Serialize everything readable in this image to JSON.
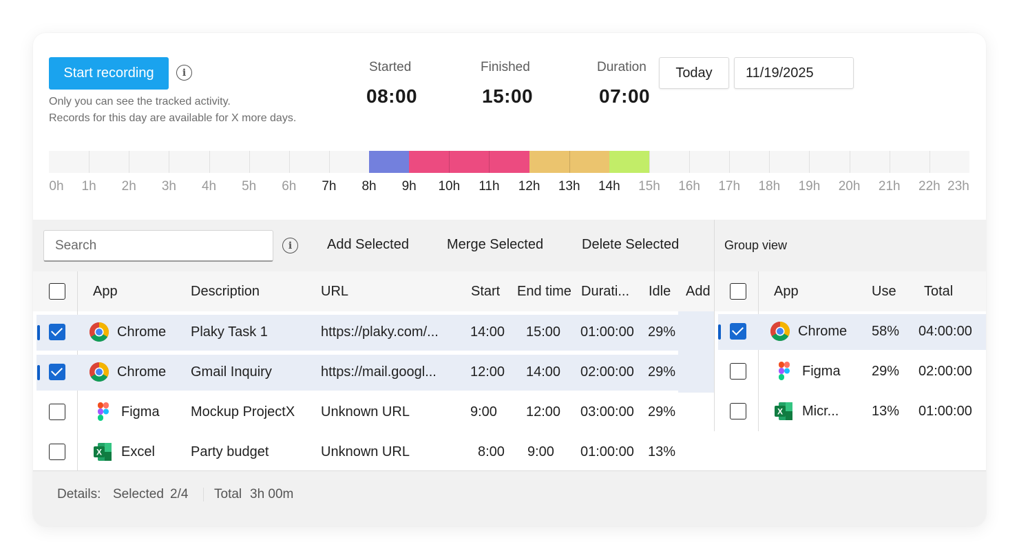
{
  "header": {
    "record_label": "Start recording",
    "note_line1": "Only you can see the tracked activity.",
    "note_line2": "Records for this day are available for X more days.",
    "started_label": "Started",
    "started_value": "08:00",
    "finished_label": "Finished",
    "finished_value": "15:00",
    "duration_label": "Duration",
    "duration_value": "07:00",
    "today_label": "Today",
    "date_value": "11/19/2025"
  },
  "timeline": {
    "hours": [
      "0h",
      "1h",
      "2h",
      "3h",
      "4h",
      "5h",
      "6h",
      "7h",
      "8h",
      "9h",
      "10h",
      "11h",
      "12h",
      "13h",
      "14h",
      "15h",
      "16h",
      "17h",
      "18h",
      "19h",
      "20h",
      "21h",
      "22h",
      "23h"
    ],
    "active_hours": [
      "7h",
      "8h",
      "9h",
      "10h",
      "11h",
      "12h",
      "13h",
      "14h"
    ],
    "segments": [
      {
        "start": 8,
        "end": 9,
        "color": "#7380dd"
      },
      {
        "start": 9,
        "end": 12,
        "color": "#ec4b80"
      },
      {
        "start": 12,
        "end": 14,
        "color": "#ebc46e"
      },
      {
        "start": 14,
        "end": 15,
        "color": "#c2ed68"
      }
    ]
  },
  "toolbar": {
    "search_placeholder": "Search",
    "add_selected": "Add Selected",
    "merge_selected": "Merge Selected",
    "delete_selected": "Delete Selected",
    "group_view": "Group view"
  },
  "activity_table": {
    "columns": [
      "App",
      "Description",
      "URL",
      "Start",
      "End time",
      "Durati...",
      "Idle",
      "Add"
    ],
    "rows": [
      {
        "selected": true,
        "app": "Chrome",
        "icon": "chrome-icon",
        "description": "Plaky Task 1",
        "url": "https://plaky.com/...",
        "start": "14:00",
        "end": "15:00",
        "duration": "01:00:00",
        "idle": "29%"
      },
      {
        "selected": true,
        "app": "Chrome",
        "icon": "chrome-icon",
        "description": "Gmail Inquiry",
        "url": "https://mail.googl...",
        "start": "12:00",
        "end": "14:00",
        "duration": "02:00:00",
        "idle": "29%"
      },
      {
        "selected": false,
        "app": "Figma",
        "icon": "figma-icon",
        "description": "Mockup ProjectX",
        "url": "Unknown URL",
        "start": "9:00",
        "end": "12:00",
        "duration": "03:00:00",
        "idle": "29%"
      },
      {
        "selected": false,
        "app": "Excel",
        "icon": "excel-icon",
        "description": "Party budget",
        "url": "Unknown URL",
        "start": "8:00",
        "end": "9:00",
        "duration": "01:00:00",
        "idle": "13%"
      }
    ]
  },
  "group_table": {
    "columns": [
      "App",
      "Use",
      "Total"
    ],
    "rows": [
      {
        "selected": true,
        "app": "Chrome",
        "icon": "chrome-icon",
        "use": "58%",
        "total": "04:00:00"
      },
      {
        "selected": false,
        "app": "Figma",
        "icon": "figma-icon",
        "use": "29%",
        "total": "02:00:00"
      },
      {
        "selected": false,
        "app": "Micr...",
        "icon": "excel-icon",
        "use": "13%",
        "total": "01:00:00"
      }
    ]
  },
  "footer": {
    "details_label": "Details:",
    "selected_label": "Selected",
    "selected_value": "2/4",
    "total_label": "Total",
    "total_value": "3h 00m"
  },
  "colors": {
    "accent": "#1aa3ee",
    "checkbox": "#1769d1",
    "selected_row": "#e8edf6"
  }
}
